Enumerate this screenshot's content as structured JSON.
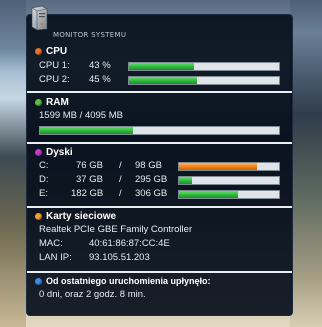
{
  "widget": {
    "title": "MONITOR SYSTEMU"
  },
  "cpu": {
    "heading": "CPU",
    "dot_color": "#e8702a",
    "cores": [
      {
        "label": "CPU 1:",
        "value": "43 %",
        "fraction": 0.43
      },
      {
        "label": "CPU 2:",
        "value": "45 %",
        "fraction": 0.45
      }
    ]
  },
  "ram": {
    "heading": "RAM",
    "dot_color": "#58c23a",
    "usage": "1599 MB / 4095 MB",
    "fraction": 0.39
  },
  "disks": {
    "heading": "Dyski",
    "dot_color": "#c23ac8",
    "items": [
      {
        "letter": "C:",
        "used": "76 GB",
        "sep": "/",
        "total": "98 GB",
        "fraction": 0.78,
        "color": "#f07d12"
      },
      {
        "letter": "D:",
        "used": "37 GB",
        "sep": "/",
        "total": "295 GB",
        "fraction": 0.13,
        "color": "#2cb33a"
      },
      {
        "letter": "E:",
        "used": "182 GB",
        "sep": "/",
        "total": "306 GB",
        "fraction": 0.59,
        "color": "#2cb33a"
      }
    ]
  },
  "network": {
    "heading": "Karty sieciowe",
    "dot_color": "#f0a030",
    "adapter": "Realtek PCIe GBE Family Controller",
    "mac_label": "MAC:",
    "mac_value": "40:61:86:87:CC:4E",
    "ip_label": "LAN IP:",
    "ip_value": "93.105.51.203"
  },
  "uptime": {
    "heading": "Od ostatniego uruchomienia upłynęło:",
    "dot_color": "#3a8ce8",
    "value": "0 dni, oraz 2 godz. 8 min."
  }
}
